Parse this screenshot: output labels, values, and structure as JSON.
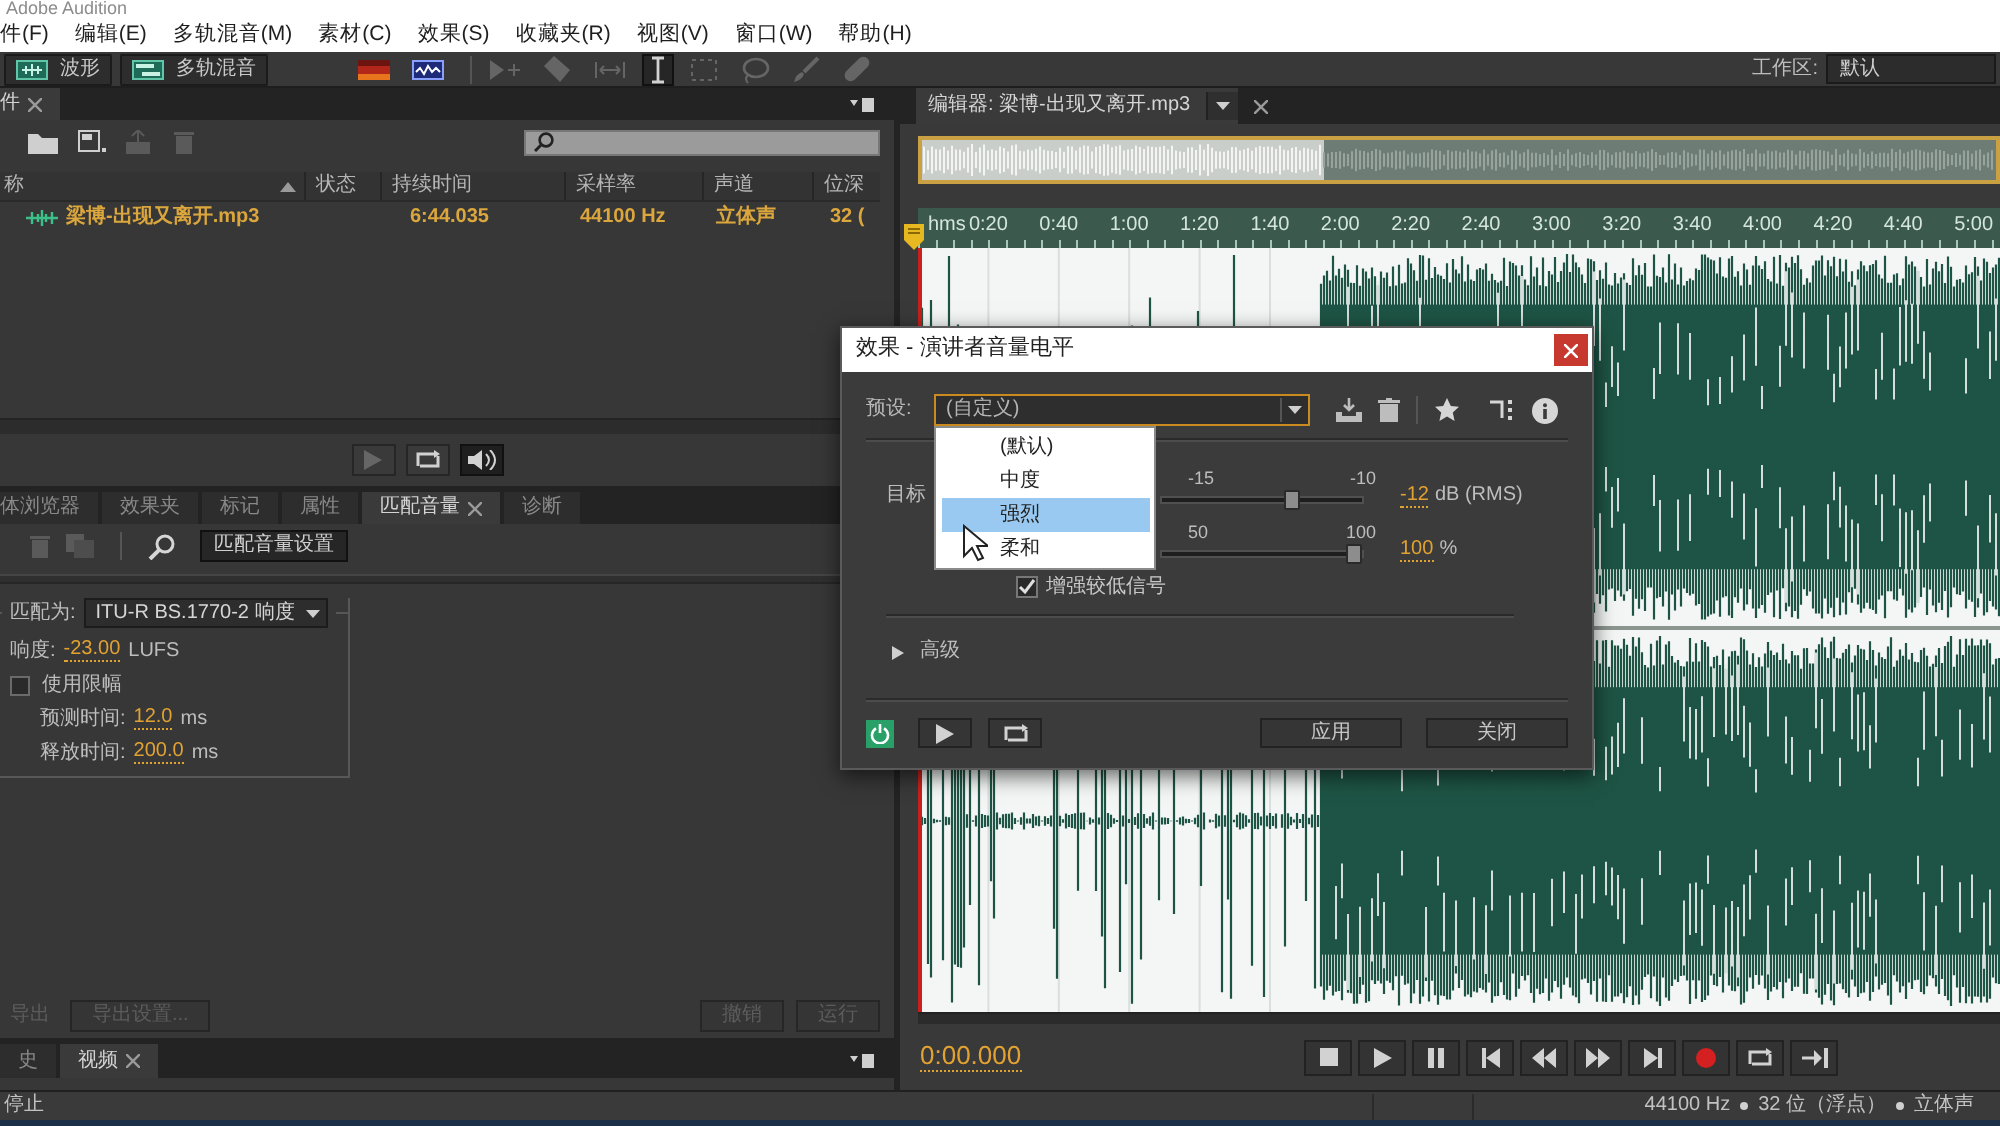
{
  "app_title": "Adobe Audition",
  "menu": [
    "件(F)",
    "编辑(E)",
    "多轨混音(M)",
    "素材(C)",
    "效果(S)",
    "收藏夹(R)",
    "视图(V)",
    "窗口(W)",
    "帮助(H)"
  ],
  "toolbar": {
    "modes": [
      {
        "kind": "waveform",
        "label": "波形"
      },
      {
        "kind": "multitrack",
        "label": "多轨混音"
      }
    ],
    "tools": [
      {
        "kind": "spectral-frequency",
        "selected": false,
        "disabled": false
      },
      {
        "kind": "spectral-pitch",
        "selected": false,
        "disabled": false
      },
      {
        "kind": "move",
        "selected": false,
        "disabled": true
      },
      {
        "kind": "razor",
        "selected": false,
        "disabled": true
      },
      {
        "kind": "slip",
        "selected": false,
        "disabled": true
      },
      {
        "kind": "time-selection",
        "selected": true,
        "disabled": false
      },
      {
        "kind": "marquee",
        "selected": false,
        "disabled": true
      },
      {
        "kind": "lasso",
        "selected": false,
        "disabled": true
      },
      {
        "kind": "brush",
        "selected": false,
        "disabled": true
      },
      {
        "kind": "heal",
        "selected": false,
        "disabled": true
      }
    ],
    "workspace": {
      "label": "工作区:",
      "value": "默认"
    }
  },
  "files_panel": {
    "tabs": [
      {
        "label": "件",
        "selected": true
      }
    ],
    "columns": [
      "称",
      "状态",
      "持续时间",
      "采样率",
      "声道",
      "位深"
    ],
    "rows": [
      {
        "name": "梁博-出现又离开.mp3",
        "duration": "6:44.035",
        "sample_rate": "44100 Hz",
        "channels": "立体声",
        "bit_depth": "32 ("
      }
    ],
    "transport": [
      {
        "kind": "play",
        "selected": false
      },
      {
        "kind": "loop",
        "selected": false
      },
      {
        "kind": "autoplay",
        "selected": true
      }
    ]
  },
  "lower_panel": {
    "tabs": [
      {
        "label": "体浏览器",
        "selected": false
      },
      {
        "label": "效果夹",
        "selected": false
      },
      {
        "label": "标记",
        "selected": false
      },
      {
        "label": "属性",
        "selected": false
      },
      {
        "label": "匹配音量",
        "selected": true
      },
      {
        "label": "诊断",
        "selected": false
      }
    ],
    "settings_button": "匹配音量设置",
    "match_to": {
      "label": "匹配为:",
      "value": "ITU-R BS.1770-2 响度"
    },
    "loudness": {
      "label": "响度:",
      "value": "-23.00",
      "unit": "LUFS"
    },
    "limiting": {
      "label": "使用限幅",
      "checked": false
    },
    "lookahead": {
      "label": "预测时间:",
      "value": "12.0",
      "unit": "ms"
    },
    "release": {
      "label": "释放时间:",
      "value": "200.0",
      "unit": "ms"
    },
    "actions": [
      {
        "kind": "link",
        "label": "导出",
        "disabled": true
      },
      {
        "kind": "button",
        "label": "导出设置...",
        "disabled": true
      },
      {
        "kind": "button",
        "label": "撤销",
        "disabled": true
      },
      {
        "kind": "button",
        "label": "运行",
        "disabled": true
      }
    ]
  },
  "bottom_tabs": [
    {
      "label": "史",
      "selected": false
    },
    {
      "label": "视频",
      "selected": true
    }
  ],
  "editor": {
    "tabs": [
      {
        "label": "编辑器: 梁博-出现又离开.mp3",
        "selected": true
      }
    ],
    "ruler": [
      "hms",
      "0:20",
      "0:40",
      "1:00",
      "1:20",
      "1:40",
      "2:00",
      "2:20",
      "2:40",
      "3:00",
      "3:20",
      "3:40",
      "4:00",
      "4:20",
      "4:40",
      "5:00"
    ],
    "time": "0:00.000",
    "transport": [
      {
        "kind": "stop"
      },
      {
        "kind": "play"
      },
      {
        "kind": "pause"
      },
      {
        "kind": "skip-back"
      },
      {
        "kind": "rewind"
      },
      {
        "kind": "fast-forward"
      },
      {
        "kind": "skip-forward"
      },
      {
        "kind": "record"
      },
      {
        "kind": "loop"
      },
      {
        "kind": "skip-selection"
      }
    ]
  },
  "dialog": {
    "title": "效果 - 演讲者音量电平",
    "preset": {
      "label": "预设:",
      "value": "(自定义)",
      "options": [
        {
          "label": "(默认)",
          "selected": false
        },
        {
          "label": "中度",
          "selected": false
        },
        {
          "label": "强烈",
          "selected": true
        },
        {
          "label": "柔和",
          "selected": false
        }
      ]
    },
    "sliders": [
      {
        "label": "目标",
        "ticks": [
          "-15",
          "-10"
        ],
        "level": 0.66,
        "value": "-12",
        "unit": "dB (RMS)"
      },
      {
        "ticks": [
          "50",
          "100"
        ],
        "level": 1,
        "value": "100",
        "unit": "%"
      }
    ],
    "boost": {
      "label": "增强较低信号",
      "checked": true
    },
    "advanced": {
      "label": "高级",
      "expanded": false
    },
    "power": {
      "on": true
    },
    "buttons": [
      "应用",
      "关闭"
    ]
  },
  "status_bar": {
    "state": "停止",
    "items": [
      "44100 Hz",
      "32 位（浮点）",
      "立体声"
    ]
  }
}
